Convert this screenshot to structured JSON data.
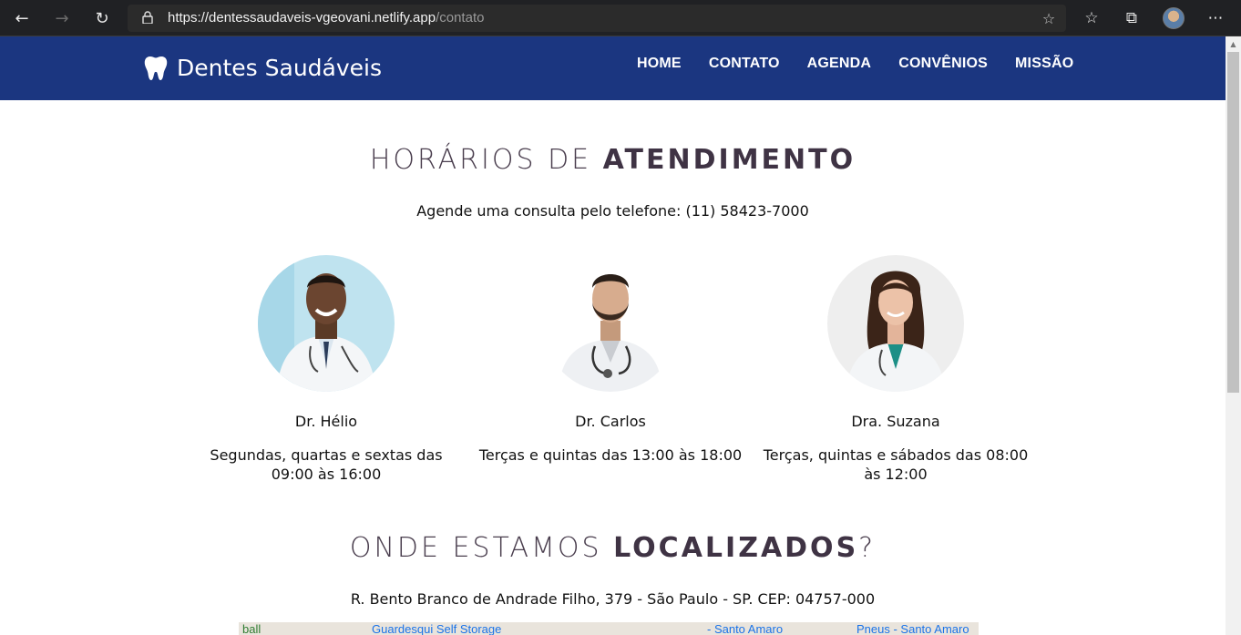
{
  "browser": {
    "url_host": "https://dentessaudaveis-vgeovani.netlify.app",
    "url_path": "/contato"
  },
  "site": {
    "brand": "Dentes Saudáveis",
    "menu": [
      "HOME",
      "CONTATO",
      "AGENDA",
      "CONVÊNIOS",
      "MISSÃO"
    ]
  },
  "schedule": {
    "title_light": "HORÁRIOS DE ",
    "title_bold": "ATENDIMENTO",
    "phone_text": "Agende uma consulta pelo telefone: (11) 58423-7000",
    "doctors": [
      {
        "name": "Dr. Hélio",
        "hours": "Segundas, quartas e sextas das 09:00 às 16:00"
      },
      {
        "name": "Dr. Carlos",
        "hours": "Terças e quintas das 13:00 às 18:00"
      },
      {
        "name": "Dra. Suzana",
        "hours": "Terças, quintas e sábados das 08:00 às 12:00"
      }
    ]
  },
  "location": {
    "title_light": "ONDE ESTAMOS ",
    "title_bold": "LOCALIZADOS",
    "title_suffix": "?",
    "address": "R. Bento Branco de Andrade Filho, 379 - São Paulo - SP. CEP: 04757-000",
    "map_labels": [
      "ball",
      "Guardesqui Self Storage",
      "- Santo Amaro",
      "Pneus - Santo Amaro"
    ]
  }
}
